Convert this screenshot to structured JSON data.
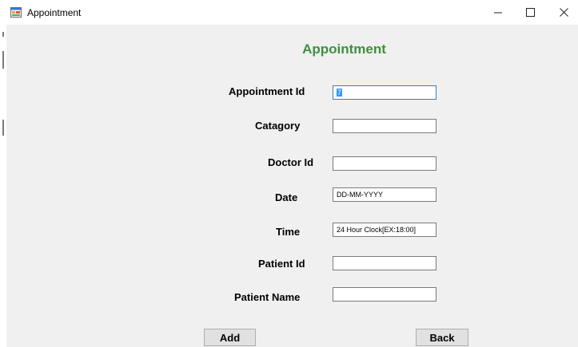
{
  "window": {
    "title": "Appointment",
    "icon": "form-app-icon",
    "controls": [
      "minimize-icon",
      "maximize-icon",
      "close-icon"
    ]
  },
  "form": {
    "heading": "Appointment",
    "heading_color": "#3f8f3f",
    "fields": [
      {
        "label": "Appointment Id",
        "value": "7",
        "selected": true
      },
      {
        "label": "Catagory",
        "value": ""
      },
      {
        "label": "Doctor Id",
        "value": ""
      },
      {
        "label": "Date",
        "value": "DD-MM-YYYY"
      },
      {
        "label": "Time",
        "value": "24 Hour Clock[EX:18:00]"
      },
      {
        "label": "Patient Id",
        "value": ""
      },
      {
        "label": "Patient Name",
        "value": ""
      }
    ]
  },
  "buttons": {
    "add": "Add",
    "back": "Back"
  }
}
